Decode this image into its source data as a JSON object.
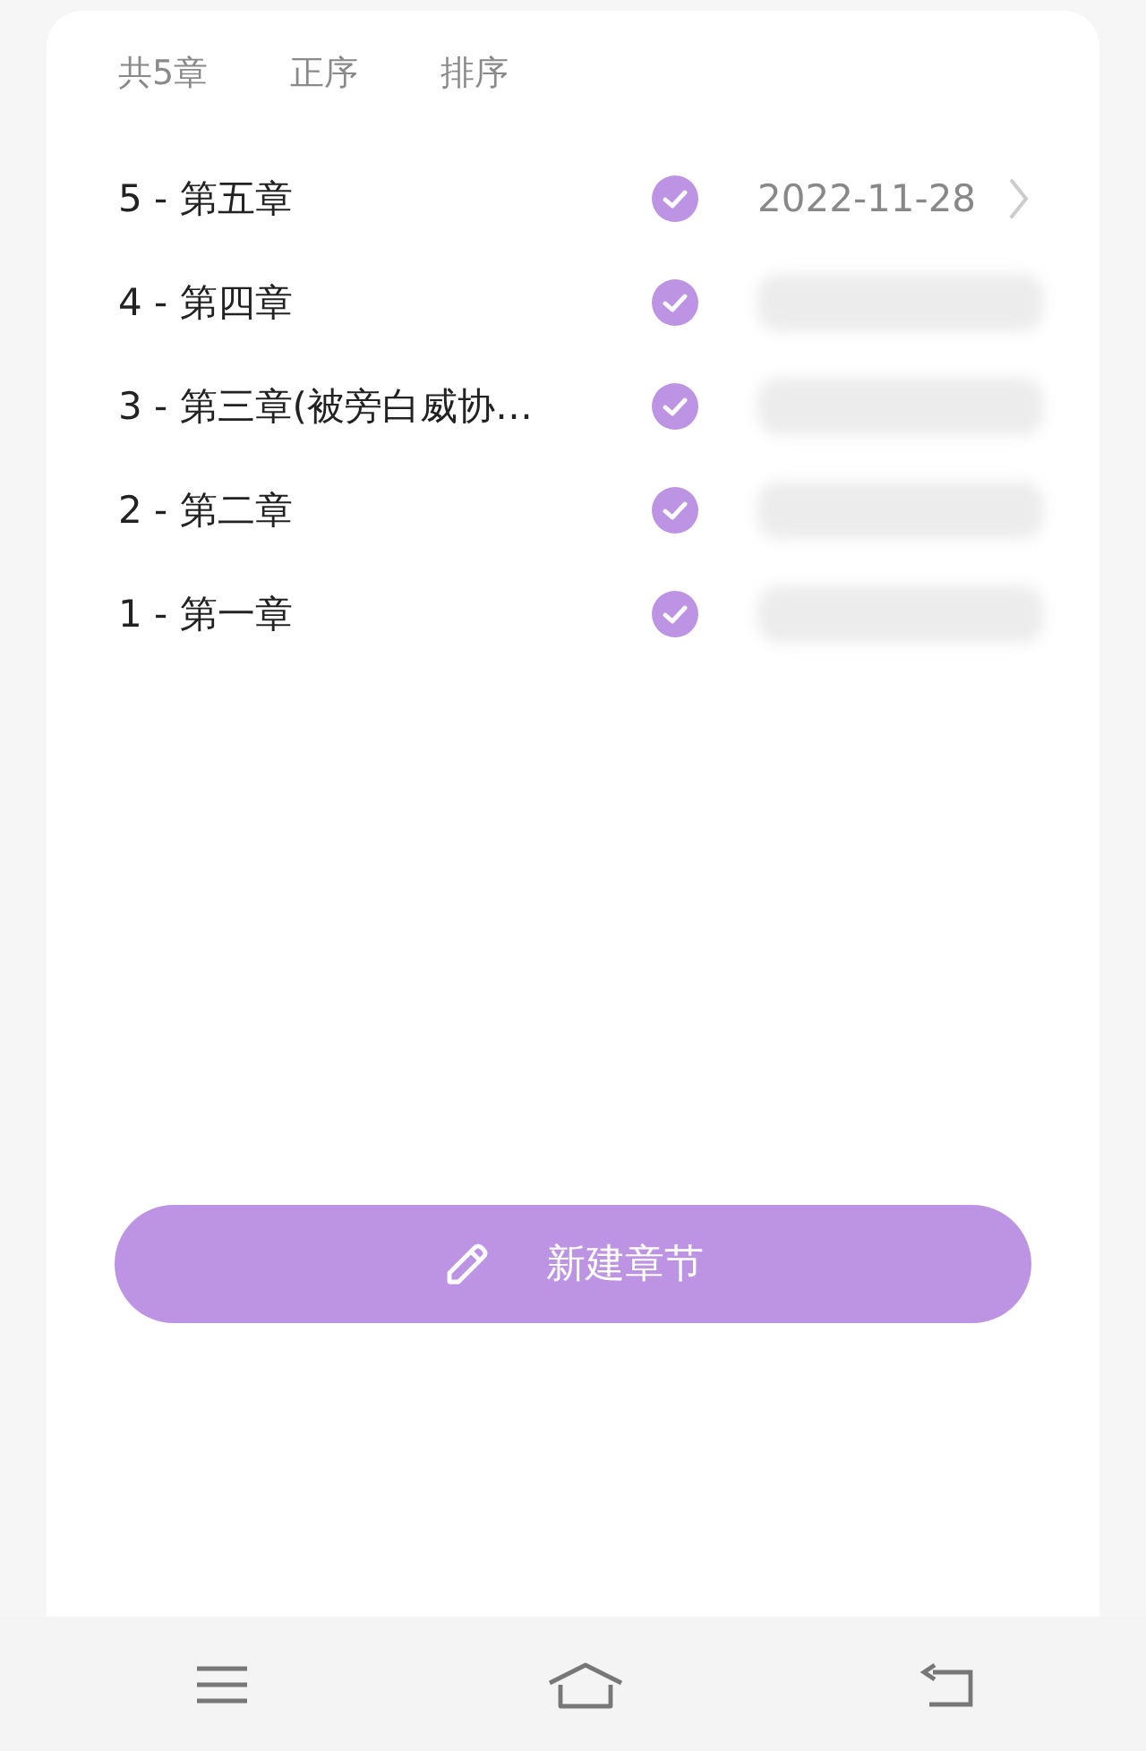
{
  "header": {
    "count": "共5章",
    "order": "正序",
    "sort": "排序"
  },
  "chapters": [
    {
      "label": "5 - 第五章",
      "checked": true,
      "date": "2022-11-28",
      "blurred": false
    },
    {
      "label": "4 - 第四章",
      "checked": true,
      "blurred": true
    },
    {
      "label": "3 -  第三章(被旁白威协…",
      "checked": true,
      "blurred": true
    },
    {
      "label": "2 -  第二章",
      "checked": true,
      "blurred": true
    },
    {
      "label": "1 -  第一章",
      "checked": true,
      "blurred": true
    }
  ],
  "new_button": {
    "label": "新建章节"
  },
  "nav_bar": [
    {
      "kind": "menu"
    },
    {
      "kind": "home"
    },
    {
      "kind": "back"
    }
  ]
}
